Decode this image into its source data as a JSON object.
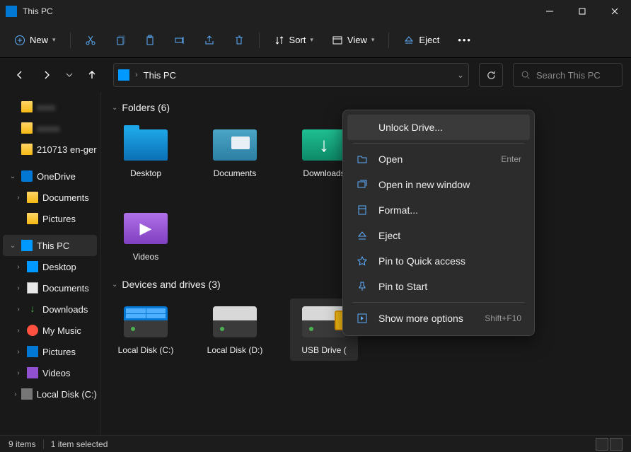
{
  "window": {
    "title": "This PC"
  },
  "toolbar": {
    "new": "New",
    "sort": "Sort",
    "view": "View",
    "eject": "Eject"
  },
  "address": {
    "crumb": "This PC"
  },
  "search": {
    "placeholder": "Search This PC"
  },
  "tree": {
    "quick1": "",
    "quick2": "",
    "quick3": "210713 en-ger",
    "onedrive": "OneDrive",
    "od_docs": "Documents",
    "od_pics": "Pictures",
    "thispc": "This PC",
    "desktop": "Desktop",
    "documents": "Documents",
    "downloads": "Downloads",
    "music": "My Music",
    "pictures": "Pictures",
    "videos": "Videos",
    "localc": "Local Disk (C:)"
  },
  "groups": {
    "folders": "Folders (6)",
    "drives": "Devices and drives (3)"
  },
  "folders": {
    "desktop": "Desktop",
    "documents": "Documents",
    "downloads": "Downloads",
    "videos": "Videos"
  },
  "drives": {
    "c": "Local Disk (C:)",
    "d": "Local Disk (D:)",
    "usb": "USB Drive ("
  },
  "context": {
    "unlock": "Unlock Drive...",
    "open": "Open",
    "open_hint": "Enter",
    "new_window": "Open in new window",
    "format": "Format...",
    "eject": "Eject",
    "pin_quick": "Pin to Quick access",
    "pin_start": "Pin to Start",
    "more": "Show more options",
    "more_hint": "Shift+F10"
  },
  "status": {
    "count": "9 items",
    "selected": "1 item selected"
  }
}
